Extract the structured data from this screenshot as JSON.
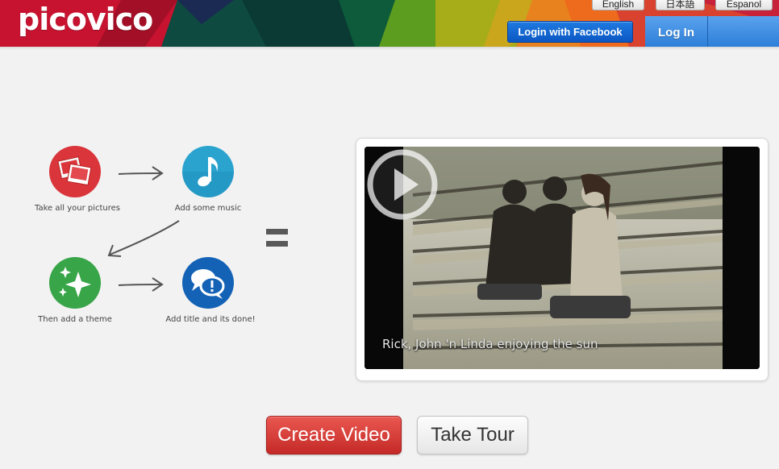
{
  "header": {
    "logo": "picovico",
    "languages": [
      "English",
      "日本語",
      "Espanol"
    ],
    "facebook_login": "Login with Facebook",
    "login": "Log In"
  },
  "steps": [
    {
      "label": "Take all your pictures",
      "icon": "pictures-icon",
      "color": "#d9353a"
    },
    {
      "label": "Add some music",
      "icon": "music-note-icon",
      "color": "#2aa3cf"
    },
    {
      "label": "Then add a theme",
      "icon": "sparkle-icon",
      "color": "#37a548"
    },
    {
      "label": "Add title and its done!",
      "icon": "speech-bubbles-icon",
      "color": "#1462b5"
    }
  ],
  "video": {
    "caption": "Rick, John 'n Linda enjoying the sun"
  },
  "cta": {
    "create_video": "Create Video",
    "take_tour": "Take Tour"
  },
  "colors": {
    "brand_red": "#c0102a",
    "facebook_blue": "#0b57c3",
    "login_blue": "#2d7fd8",
    "create_red": "#d63c37"
  }
}
